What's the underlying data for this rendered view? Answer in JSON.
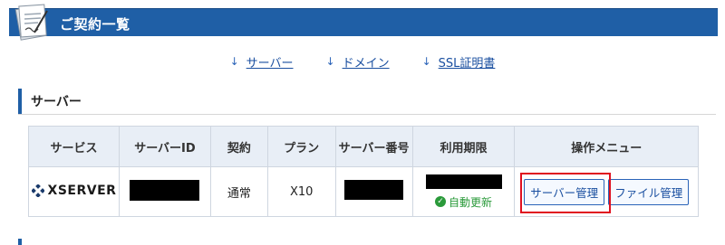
{
  "header": {
    "title": "ご契約一覧"
  },
  "anchors": [
    {
      "label": "サーバー"
    },
    {
      "label": "ドメイン"
    },
    {
      "label": "SSL証明書"
    }
  ],
  "section": {
    "title": "サーバー"
  },
  "table": {
    "headers": [
      "サービス",
      "サーバーID",
      "契約",
      "プラン",
      "サーバー番号",
      "利用期限",
      "操作メニュー"
    ],
    "row": {
      "service": "XSERVER",
      "contract": "通常",
      "plan": "X10",
      "renewal": "自動更新",
      "buttons": {
        "server_manage": "サーバー管理",
        "file_manage": "ファイル管理"
      }
    }
  },
  "colors": {
    "brand_blue": "#1f5fa6",
    "highlight": "#e0101f",
    "renew_green": "#2a9a3a"
  }
}
